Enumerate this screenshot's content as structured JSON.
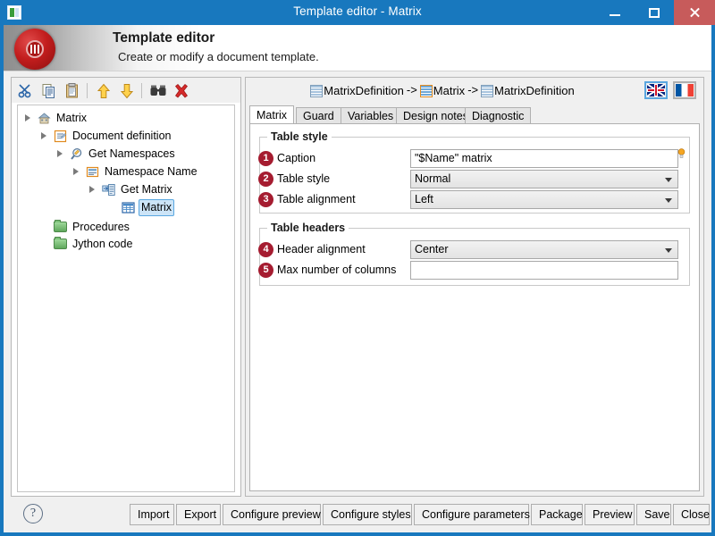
{
  "window": {
    "title": "Template editor - Matrix",
    "app_icon": "app-window-icon",
    "minimize": "–",
    "maximize": "□",
    "close": "×"
  },
  "banner": {
    "title": "Template editor",
    "subtitle": "Create or modify a document template.",
    "logo": "red-disc-logo"
  },
  "tree_toolbar": {
    "items": [
      {
        "name": "cut-icon",
        "tip": "Cut"
      },
      {
        "name": "copy-icon",
        "tip": "Copy"
      },
      {
        "name": "paste-icon",
        "tip": "Paste"
      },
      {
        "name": "move-up-icon",
        "tip": "Move up"
      },
      {
        "name": "move-down-icon",
        "tip": "Move down"
      },
      {
        "name": "find-icon",
        "tip": "Find"
      },
      {
        "name": "delete-icon",
        "tip": "Delete"
      }
    ]
  },
  "tree": {
    "nodes": [
      {
        "label": "Matrix",
        "depth": 0,
        "icon": "house-icon",
        "expanded": true,
        "selected": false
      },
      {
        "label": "Document definition",
        "depth": 1,
        "icon": "document-icon",
        "expanded": true,
        "selected": false
      },
      {
        "label": "Get Namespaces",
        "depth": 2,
        "icon": "magnifier-icon",
        "expanded": true,
        "selected": false
      },
      {
        "label": "Namespace Name",
        "depth": 3,
        "icon": "name-icon",
        "expanded": true,
        "selected": false
      },
      {
        "label": "Get Matrix",
        "depth": 4,
        "icon": "get-matrix-icon",
        "expanded": true,
        "selected": false
      },
      {
        "label": "Matrix",
        "depth": 5,
        "icon": "matrix-grid-icon",
        "expanded": false,
        "selected": true
      },
      {
        "label": "Procedures",
        "depth": 1,
        "icon": "folder-icon",
        "expanded": false,
        "selected": false
      },
      {
        "label": "Jython code",
        "depth": 1,
        "icon": "folder-icon",
        "expanded": false,
        "selected": false
      }
    ]
  },
  "breadcrumb": {
    "separator": "->",
    "items": [
      {
        "label": "MatrixDefinition",
        "icon": "matrix-grid-icon",
        "active": false
      },
      {
        "label": "Matrix",
        "icon": "matrix-grid-icon",
        "active": true
      },
      {
        "label": "MatrixDefinition",
        "icon": "matrix-grid-icon",
        "active": false
      }
    ]
  },
  "language": {
    "buttons": [
      {
        "name": "flag-en",
        "label": "English",
        "selected": true
      },
      {
        "name": "flag-fr",
        "label": "French",
        "selected": false
      }
    ]
  },
  "tabs": [
    {
      "label": "Matrix",
      "active": true
    },
    {
      "label": "Guard",
      "active": false
    },
    {
      "label": "Variables",
      "active": false
    },
    {
      "label": "Design notes",
      "active": false
    },
    {
      "label": "Diagnostic",
      "active": false
    }
  ],
  "groups": {
    "table_style": {
      "title": "Table style",
      "fields": [
        {
          "badge": "1",
          "label": "Caption",
          "type": "text",
          "value": "\"$Name\" matrix",
          "placeholder": ""
        },
        {
          "badge": "2",
          "label": "Table style",
          "type": "combo",
          "value": "Normal"
        },
        {
          "badge": "3",
          "label": "Table alignment",
          "type": "combo",
          "value": "Left"
        }
      ],
      "hint_icon": "lightbulb-icon"
    },
    "table_headers": {
      "title": "Table headers",
      "fields": [
        {
          "badge": "4",
          "label": "Header alignment",
          "type": "combo",
          "value": "Center"
        },
        {
          "badge": "5",
          "label": "Max number of columns",
          "type": "text",
          "value": "",
          "placeholder": ""
        }
      ]
    }
  },
  "footer": {
    "help": "?",
    "buttons": [
      {
        "label": "Import"
      },
      {
        "label": "Export"
      },
      {
        "label": "Configure preview"
      },
      {
        "label": "Configure styles"
      },
      {
        "label": "Configure parameters"
      },
      {
        "label": "Package"
      },
      {
        "label": "Preview"
      },
      {
        "label": "Save"
      },
      {
        "label": "Close"
      }
    ]
  },
  "colors": {
    "window_frame": "#1878be",
    "close_button": "#c75b5b",
    "badge": "#a51c30",
    "selection": "#cce4f7",
    "selection_border": "#5aa7e0",
    "accent_orange": "#e08a20"
  }
}
